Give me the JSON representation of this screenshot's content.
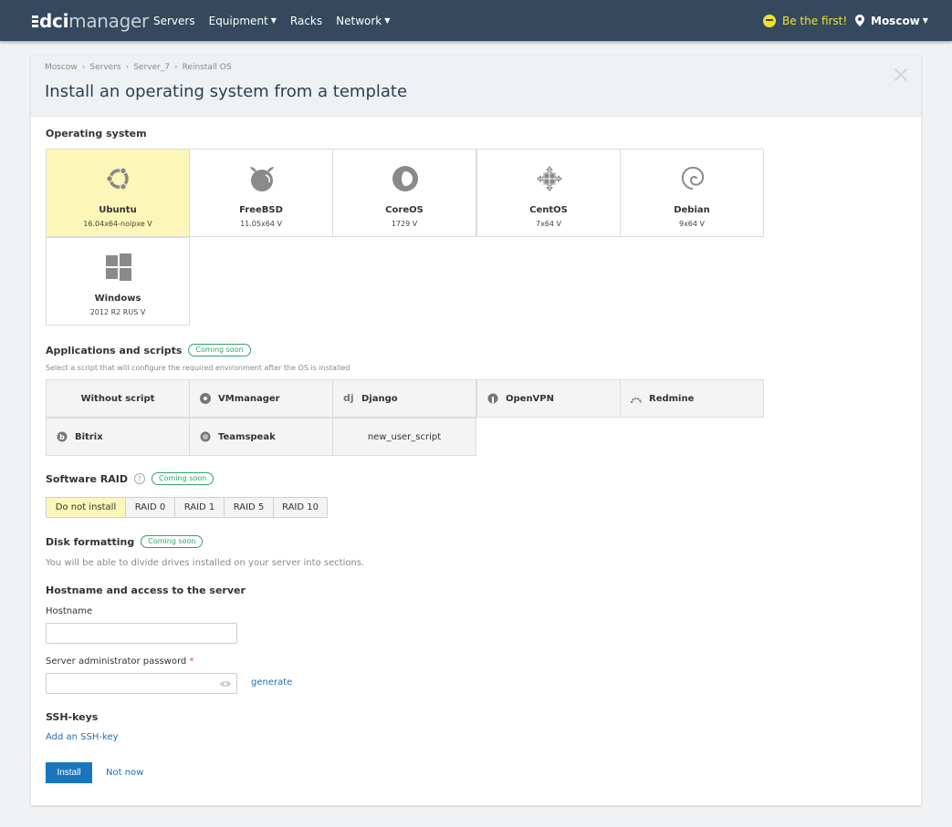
{
  "topbar": {
    "logo_prefix": "dci",
    "logo_suffix": "manager",
    "nav": [
      {
        "label": "Servers",
        "dropdown": false
      },
      {
        "label": "Equipment",
        "dropdown": true
      },
      {
        "label": "Racks",
        "dropdown": false
      },
      {
        "label": "Network",
        "dropdown": true
      }
    ],
    "promo": "Be the first!",
    "location": "Moscow",
    "chevron": "⌄"
  },
  "breadcrumb": [
    "Moscow",
    "Servers",
    "Server_7",
    "Reinstall OS"
  ],
  "breadcrumb_sep": "›",
  "page_title": "Install an operating system from a template",
  "os_section": {
    "title": "Operating system",
    "items": [
      {
        "name": "Ubuntu",
        "version": "16.04x64-noipxe V",
        "icon": "ubuntu-icon",
        "selected": true
      },
      {
        "name": "FreeBSD",
        "version": "11.05x64 V",
        "icon": "freebsd-icon",
        "selected": false
      },
      {
        "name": "CoreOS",
        "version": "1729 V",
        "icon": "coreos-icon",
        "selected": false
      },
      {
        "name": "CentOS",
        "version": "7x64 V",
        "icon": "centos-icon",
        "selected": false
      },
      {
        "name": "Debian",
        "version": "9x64 V",
        "icon": "debian-icon",
        "selected": false
      },
      {
        "name": "Windows",
        "version": "2012 R2 RUS V",
        "icon": "windows-icon",
        "selected": false
      }
    ]
  },
  "apps_section": {
    "title": "Applications and scripts",
    "badge": "Coming soon",
    "hint": "Select a script that will configure the required environment after the OS is installed",
    "items": [
      {
        "label": "Without script",
        "icon": ""
      },
      {
        "label": "VMmanager",
        "icon": "vmmanager-icon"
      },
      {
        "label": "Django",
        "icon": "django-icon"
      },
      {
        "label": "OpenVPN",
        "icon": "openvpn-icon"
      },
      {
        "label": "Redmine",
        "icon": "redmine-icon"
      },
      {
        "label": "Bitrix",
        "icon": "bitrix-icon"
      },
      {
        "label": "Teamspeak",
        "icon": "teamspeak-icon"
      },
      {
        "label": "new_user_script",
        "icon": ""
      }
    ]
  },
  "raid_section": {
    "title": "Software RAID",
    "help": "?",
    "badge": "Coming soon",
    "options": [
      "Do not install",
      "RAID 0",
      "RAID 1",
      "RAID 5",
      "RAID 10"
    ],
    "selected": "Do not install"
  },
  "disk_section": {
    "title": "Disk formatting",
    "badge": "Coming soon",
    "text": "You will be able to divide drives installed on your server into sections."
  },
  "access_section": {
    "title": "Hostname and access to the server",
    "hostname_label": "Hostname",
    "hostname_value": "",
    "password_label": "Server administrator password",
    "required_mark": "*",
    "password_value": "",
    "generate_link": "generate"
  },
  "ssh_section": {
    "title": "SSH-keys",
    "add_link": "Add an SSH-key"
  },
  "actions": {
    "install": "Install",
    "cancel": "Not now"
  },
  "colors": {
    "topbar": "#34495e",
    "selected": "#fdf6b9",
    "primary": "#1976bd",
    "link": "#1f6fb2",
    "promo": "#f0e130",
    "badge": "#2ea36a"
  }
}
